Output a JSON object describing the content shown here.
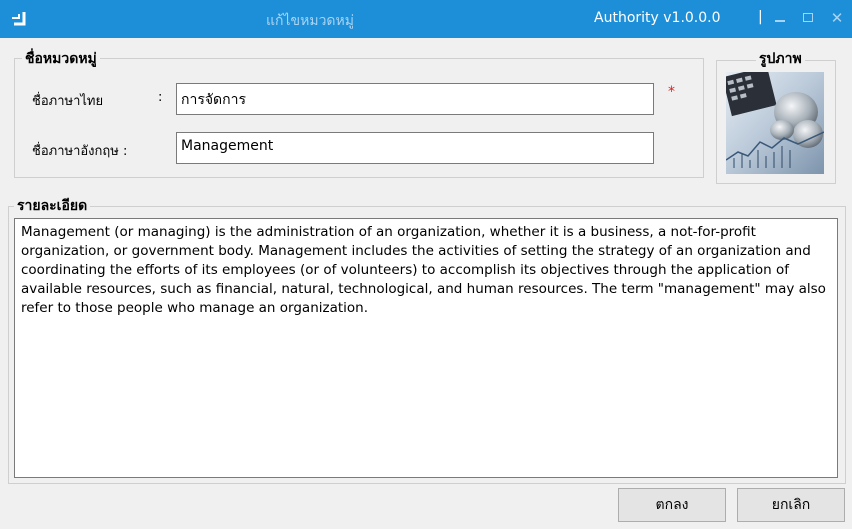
{
  "window": {
    "title": "แก้ไขหมวดหมู่",
    "version": "Authority v1.0.0.0",
    "separator": "|"
  },
  "category_group": {
    "legend": "ชื่อหมวดหมู่",
    "thai_label": "ชื่อภาษาไทย",
    "thai_colon": ":",
    "thai_value": "การจัดการ",
    "required_mark": "*",
    "english_label": "ชื่อภาษาอังกฤษ :",
    "english_value": "Management"
  },
  "image_group": {
    "legend": "รูปภาพ"
  },
  "detail_group": {
    "legend": "รายละเอียด",
    "text": "Management (or managing) is the administration of an organization, whether it is a business, a not-for-profit organization, or government body. Management includes the activities of setting the strategy of an organization and coordinating the efforts of its employees (or of volunteers) to accomplish its objectives through the application of available resources, such as financial, natural, technological, and human resources. The term \"management\" may also refer to those people who manage an organization."
  },
  "buttons": {
    "ok": "ตกลง",
    "cancel": "ยกเลิก"
  },
  "icons": {
    "app": "app-logo-icon",
    "minimize": "minimize-icon",
    "maximize": "maximize-icon",
    "close": "close-icon"
  },
  "colors": {
    "titlebar": "#1d8fd8",
    "required": "#e02020"
  }
}
